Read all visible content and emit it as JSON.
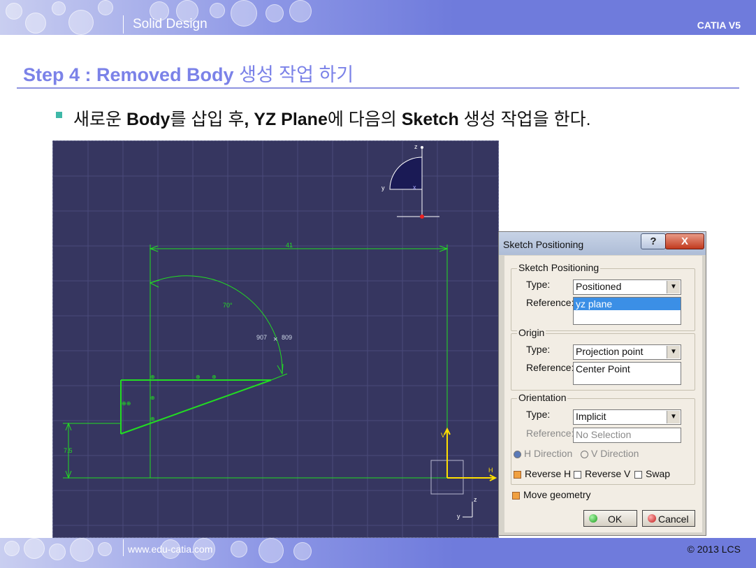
{
  "header": {
    "title": "Solid Design",
    "brand": "CATIA V5"
  },
  "slide": {
    "step_label": "Step 4 : Removed Body",
    "step_korean": "생성 작업 하기",
    "instruction": {
      "part1": "새로운 ",
      "bold1": "Body",
      "part2": "를 삽입 후",
      "bold2": ", YZ Plane",
      "part3": "에 다음의 ",
      "bold3": "Sketch",
      "part4": " 생성 작업을 한다."
    }
  },
  "sketch": {
    "dim_41": "41",
    "dim_70deg": "70°",
    "coord_left": "907",
    "coord_right": "809",
    "dim_75": "7.5",
    "compass_z": "z",
    "compass_y": "y",
    "compass_x": "x",
    "axis_h": "H",
    "axis_v": "V",
    "mini_z": "z",
    "mini_y": "y",
    "colors": {
      "background": "#363660",
      "geometry": "#22dd22",
      "axis": "#ffe000"
    }
  },
  "dialog": {
    "title": "Sketch Positioning",
    "help_label": "?",
    "close_label": "X",
    "positioning": {
      "group_label": "Sketch Positioning",
      "type_label": "Type:",
      "type_value": "Positioned",
      "reference_label": "Reference:",
      "reference_value": "yz plane"
    },
    "origin": {
      "group_label": "Origin",
      "type_label": "Type:",
      "type_value": "Projection point",
      "reference_label": "Reference:",
      "reference_value": "Center Point"
    },
    "orientation": {
      "group_label": "Orientation",
      "type_label": "Type:",
      "type_value": "Implicit",
      "reference_label": "Reference:",
      "reference_value": "No Selection",
      "h_direction": "H Direction",
      "v_direction": "V Direction",
      "reverse_h": "Reverse H",
      "reverse_v": "Reverse V",
      "swap": "Swap"
    },
    "move_geometry": "Move geometry",
    "ok_label": "OK",
    "cancel_label": "Cancel"
  },
  "footer": {
    "url": "www.edu-catia.com",
    "copyright": "© 2013 LCS"
  }
}
